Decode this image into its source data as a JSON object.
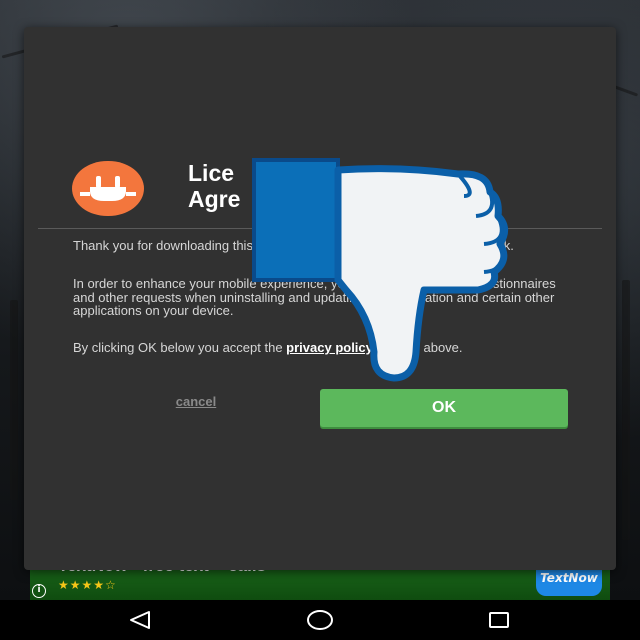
{
  "dialog": {
    "title": "License Agreement",
    "title_line1": "Lice",
    "title_line2": "Agre",
    "paragraph1": "Thank you for downloading this application, powered by the AppJolt network.",
    "paragraph2": "In order to enhance your mobile experience, you may receive survey questionnaires and other requests when uninstalling and updating this application and certain other applications on your device.",
    "paragraph3_prefix": "By clicking OK below you accept the ",
    "paragraph3_link": "privacy policy",
    "paragraph3_suffix": " and the above.",
    "cancel_label": "cancel",
    "ok_label": "OK",
    "icon": "plug-icon",
    "accent_color": "#5cb85c",
    "icon_color": "#f3763d"
  },
  "overlay": {
    "icon": "thumbs-down-icon",
    "color": "#0b6fb8"
  },
  "ad": {
    "title": "TextNow - free text + calls",
    "rating": "★★★★☆",
    "info_label": "i",
    "logo_label": "TextNow"
  },
  "nav": {
    "back_icon": "back-icon",
    "home_icon": "home-icon",
    "recent_icon": "recent-apps-icon"
  }
}
